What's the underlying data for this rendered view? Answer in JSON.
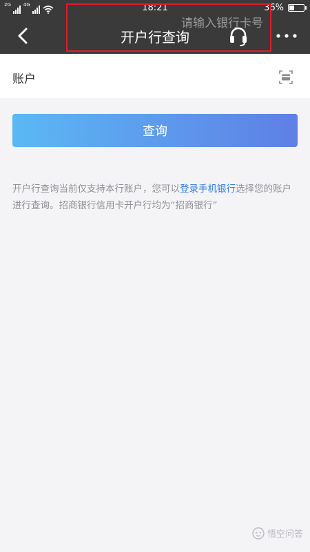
{
  "status_bar": {
    "network_1": "2G",
    "network_2": "4G",
    "time": "18:21",
    "battery_text": "36%",
    "battery_level": 0.36
  },
  "nav": {
    "title": "开户行查询",
    "back_icon": "chevron-left-icon",
    "service_icon": "headset-icon",
    "more_icon": "more-dots-icon"
  },
  "form": {
    "account_label": "账户",
    "account_value": "",
    "account_placeholder": "请输入银行卡号",
    "card_icon": "card-scan-icon"
  },
  "query_button": {
    "label": "查询"
  },
  "note": {
    "text_before": "开户行查询当前仅支持本行账户，您可以",
    "link_text": "登录手机银行",
    "text_after": "选择您的账户进行查询。招商银行信用卡开户行均为“招商银行”"
  },
  "colors": {
    "header_bg": "#3a3a3a",
    "page_bg": "#f4f4f7",
    "highlight_border": "#e01c2c",
    "button_gradient_start": "#5bb8f4",
    "button_gradient_end": "#5f7fe6",
    "link": "#2e7be6"
  },
  "watermark": {
    "text": "悟空问答",
    "icon": "wukong-logo-icon"
  }
}
